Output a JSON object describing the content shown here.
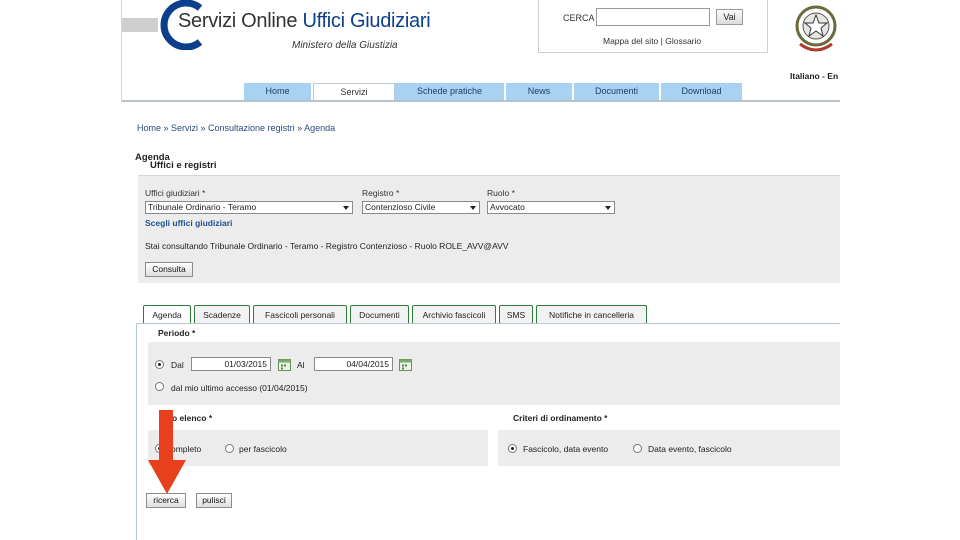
{
  "header": {
    "logo_title_part1": "Servizi Online",
    "logo_title_part2": "Uffici Giudiziari",
    "logo_subtitle": "Ministero della Giustizia",
    "search_label": "CERCA",
    "search_value": "",
    "search_button": "Vai",
    "search_links": "Mappa del sito | Glossario",
    "language": "Italiano - En"
  },
  "nav": {
    "tabs": [
      "Home",
      "Servizi",
      "Schede pratiche",
      "News",
      "Documenti",
      "Download"
    ],
    "active": "Servizi"
  },
  "breadcrumb": "Home » Servizi » Consultazione registri » Agenda",
  "page": {
    "title": "Agenda",
    "section_title": "Uffici e registri"
  },
  "filters": {
    "uffici_label": "Uffici giudiziari *",
    "uffici_value": "Tribunale Ordinario - Teramo",
    "registro_label": "Registro *",
    "registro_value": "Contenzioso Civile",
    "ruolo_label": "Ruolo *",
    "ruolo_value": "Avvocato",
    "scegli_link": "Scegli uffici giudiziari",
    "status_text": "Stai consultando Tribunale Ordinario - Teramo - Registro Contenzioso - Ruolo ROLE_AVV@AVV",
    "consulta_button": "Consulta"
  },
  "tabs": [
    "Agenda",
    "Scadenze",
    "Fascicoli personali",
    "Documenti",
    "Archivio fascicoli",
    "SMS",
    "Notifiche in cancelleria"
  ],
  "periodo": {
    "label": "Periodo *",
    "dal_label": "Dal",
    "dal_value": "01/03/2015",
    "al_label": "Al",
    "al_value": "04/04/2015",
    "since_last": "dal mio ultimo accesso (01/04/2015)"
  },
  "tipo_elenco": {
    "label": "o elenco *",
    "option1": "ompleto",
    "option2": "per fascicolo"
  },
  "criteri": {
    "label": "Criteri di ordinamento *",
    "option1": "Fascicolo, data evento",
    "option2": "Data evento, fascicolo"
  },
  "actions": {
    "ricerca_button": "ricerca",
    "pulisci_button": "pulisci"
  },
  "colors": {
    "nav_tab": "#a7d2f1",
    "panel_bg": "#ececec",
    "link_blue": "#1f4f8e",
    "tab_border": "#2f7d3a",
    "arrow_red": "#e8401c"
  }
}
